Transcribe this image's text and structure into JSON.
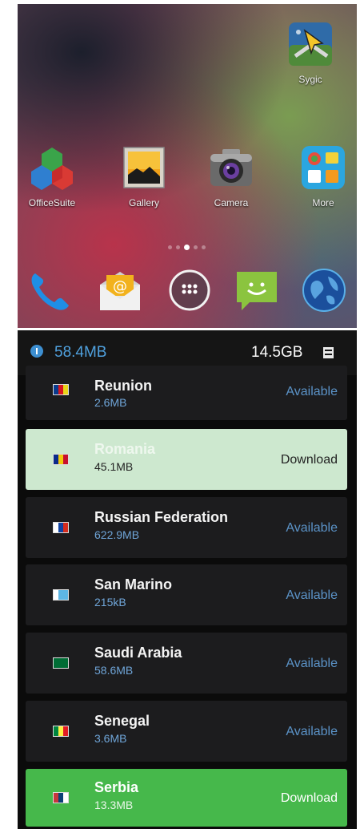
{
  "home": {
    "apps": [
      {
        "label": "Sygic",
        "icon": "sygic-icon"
      },
      {
        "label": "OfficeSuite",
        "icon": "officesuite-icon"
      },
      {
        "label": "Gallery",
        "icon": "gallery-icon"
      },
      {
        "label": "Camera",
        "icon": "camera-icon"
      },
      {
        "label": "More",
        "icon": "folder-icon"
      }
    ],
    "pager": {
      "pages": 5,
      "current": 3
    },
    "dock": [
      {
        "icon": "phone-icon"
      },
      {
        "icon": "email-icon"
      },
      {
        "icon": "app-drawer-icon"
      },
      {
        "icon": "messaging-icon"
      },
      {
        "icon": "browser-globe-icon"
      }
    ]
  },
  "maps": {
    "status_bar": {
      "download_size": "58.4MB",
      "free_space": "14.5GB",
      "info_icon": "info-icon",
      "storage_icon": "sd-card-icon"
    },
    "rows": [
      {
        "name": "Reunion",
        "size": "2.6MB",
        "status": "Available",
        "flag": [
          "#0a3a8c",
          "#d8161f",
          "#e9d51a"
        ]
      },
      {
        "name": "Romania",
        "size": "45.1MB",
        "status": "Download",
        "flag": [
          "#0b2a8a",
          "#f1c80d",
          "#c8102e"
        ]
      },
      {
        "name": "Russian Federation",
        "size": "622.9MB",
        "status": "Available",
        "flag": [
          "#ffffff",
          "#1143a3",
          "#d52b1e"
        ]
      },
      {
        "name": "San Marino",
        "size": "215kB",
        "status": "Available",
        "flag": [
          "#ffffff",
          "#5eb6e4",
          "#5eb6e4"
        ]
      },
      {
        "name": "Saudi Arabia",
        "size": "58.6MB",
        "status": "Available",
        "flag": [
          "#006c35",
          "#006c35",
          "#006c35"
        ]
      },
      {
        "name": "Senegal",
        "size": "3.6MB",
        "status": "Available",
        "flag": [
          "#00853f",
          "#fdef42",
          "#e31b23"
        ]
      },
      {
        "name": "Serbia",
        "size": "13.3MB",
        "status": "Download",
        "flag": [
          "#c6363c",
          "#0c4076",
          "#ffffff"
        ]
      }
    ]
  }
}
